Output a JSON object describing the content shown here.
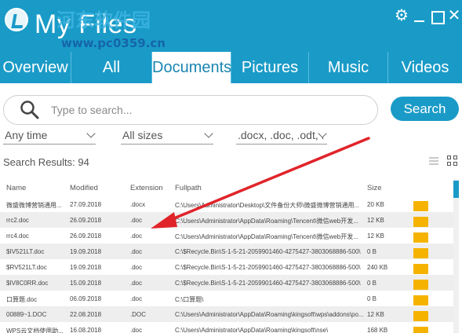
{
  "app": {
    "title": "My Files",
    "watermark_cn": "河东软件园",
    "watermark_url": "www.pc0359.cn"
  },
  "window_controls": {
    "settings_icon": "gear-icon",
    "minimize_icon": "minimize-icon",
    "maximize_icon": "maximize-icon",
    "close_icon": "close-icon"
  },
  "tabs": [
    {
      "label": "Overview",
      "active": false
    },
    {
      "label": "All",
      "active": false
    },
    {
      "label": "Documents",
      "active": true
    },
    {
      "label": "Pictures",
      "active": false
    },
    {
      "label": "Music",
      "active": false
    },
    {
      "label": "Videos",
      "active": false
    }
  ],
  "search": {
    "placeholder": "Type to search...",
    "value": "",
    "button_label": "Search"
  },
  "filters": {
    "time": "Any time",
    "size": "All sizes",
    "extensions": ".docx, .doc, .odt, ."
  },
  "results": {
    "label": "Search Results:",
    "count": "94"
  },
  "table": {
    "columns": [
      "Name",
      "Modified",
      "Extension",
      "Fullpath",
      "Size"
    ],
    "rows": [
      {
        "name": "微盛微博营销通用...",
        "modified": "27.09.2018",
        "ext": ".docx",
        "path": "C:\\Users\\Administrator\\Desktop\\文件备份大师\\微盛微博营销通用...",
        "size": "20 KB"
      },
      {
        "name": "rrc2.doc",
        "modified": "26.09.2018",
        "ext": ".doc",
        "path": "C:\\Users\\Administrator\\AppData\\Roaming\\Tencent\\微信web开发...",
        "size": "12 KB"
      },
      {
        "name": "rrc4.doc",
        "modified": "26.09.2018",
        "ext": ".doc",
        "path": "C:\\Users\\Administrator\\AppData\\Roaming\\Tencent\\微信web开发...",
        "size": "12 KB"
      },
      {
        "name": "$IV521LT.doc",
        "modified": "19.09.2018",
        "ext": ".doc",
        "path": "C:\\$Recycle.Bin\\S-1-5-21-2059901460-4275427-3803068886-500\\",
        "size": "0 B"
      },
      {
        "name": "$RV521LT.doc",
        "modified": "19.09.2018",
        "ext": ".doc",
        "path": "C:\\$Recycle.Bin\\S-1-5-21-2059901460-4275427-3803068886-500\\",
        "size": "240 KB"
      },
      {
        "name": "$IV8C0RR.doc",
        "modified": "15.09.2018",
        "ext": ".doc",
        "path": "C:\\$Recycle.Bin\\S-1-5-21-2059901460-4275427-3803068886-500\\",
        "size": "0 B"
      },
      {
        "name": "口算题.doc",
        "modified": "06.09.2018",
        "ext": ".doc",
        "path": "C:\\口算题\\",
        "size": "0 B"
      },
      {
        "name": "00889~1.DOC",
        "modified": "22.08.2018",
        "ext": ".DOC",
        "path": "C:\\Users\\Administrator\\AppData\\Roaming\\kingsoft\\wps\\addons\\po...",
        "size": "12 KB"
      },
      {
        "name": "WPS云文档使用助...",
        "modified": "16.08.2018",
        "ext": ".doc",
        "path": "C:\\Users\\Administrator\\AppData\\Roaming\\kingsoft\\nse\\",
        "size": "168 KB"
      }
    ]
  },
  "colors": {
    "accent": "#1a9bc7",
    "folder": "#f5b300",
    "annotation_arrow": "#e0242a"
  }
}
